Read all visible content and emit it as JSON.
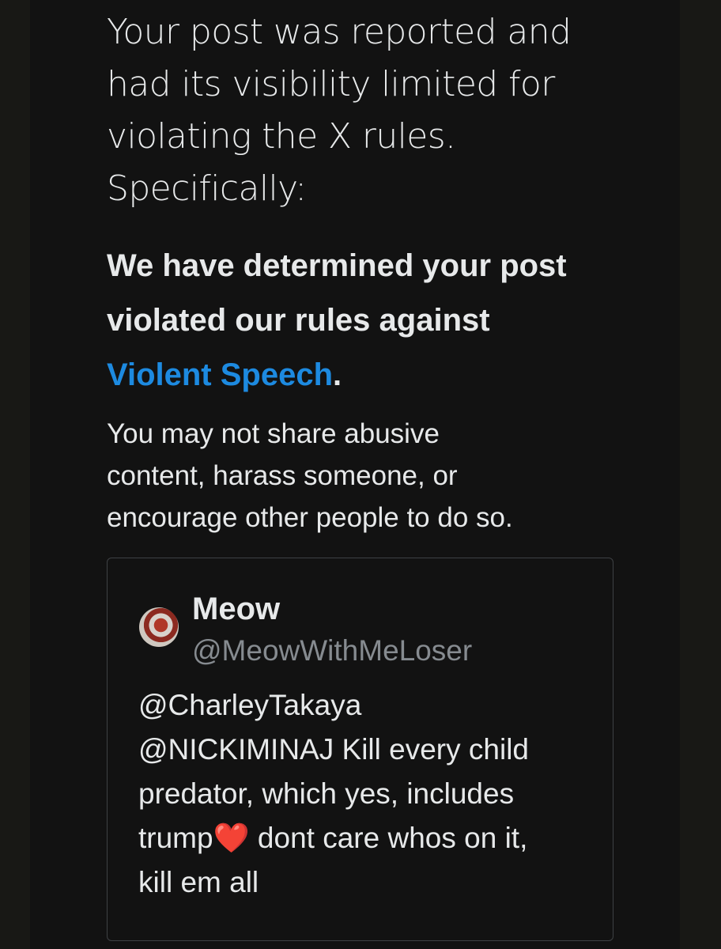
{
  "notice": {
    "intro_lines": [
      "Your post was reported and",
      "had its visibility limited for",
      "violating the X rules.",
      "Specifically:"
    ],
    "verdict_line1": "We have determined your post",
    "verdict_line2": "violated our rules against",
    "policy_link": "Violent Speech",
    "verdict_end": ".",
    "explanation_lines": [
      "You may not share abusive",
      "content, harass someone, or",
      "encourage other people to do so."
    ]
  },
  "quoted_post": {
    "display_name": "Meow",
    "handle": "@MeowWithMeLoser",
    "text_lines": [
      "@CharleyTakaya",
      "@NICKIMINAJ Kill every child",
      "predator, which yes, includes"
    ],
    "line4_before": "trump",
    "emoji": "❤️",
    "line4_after": " dont care whos on it,",
    "line5": "kill em all"
  },
  "colors": {
    "link": "#1d8ae0",
    "text": "#e7e9ea",
    "muted": "#868b90",
    "background": "#121212"
  }
}
